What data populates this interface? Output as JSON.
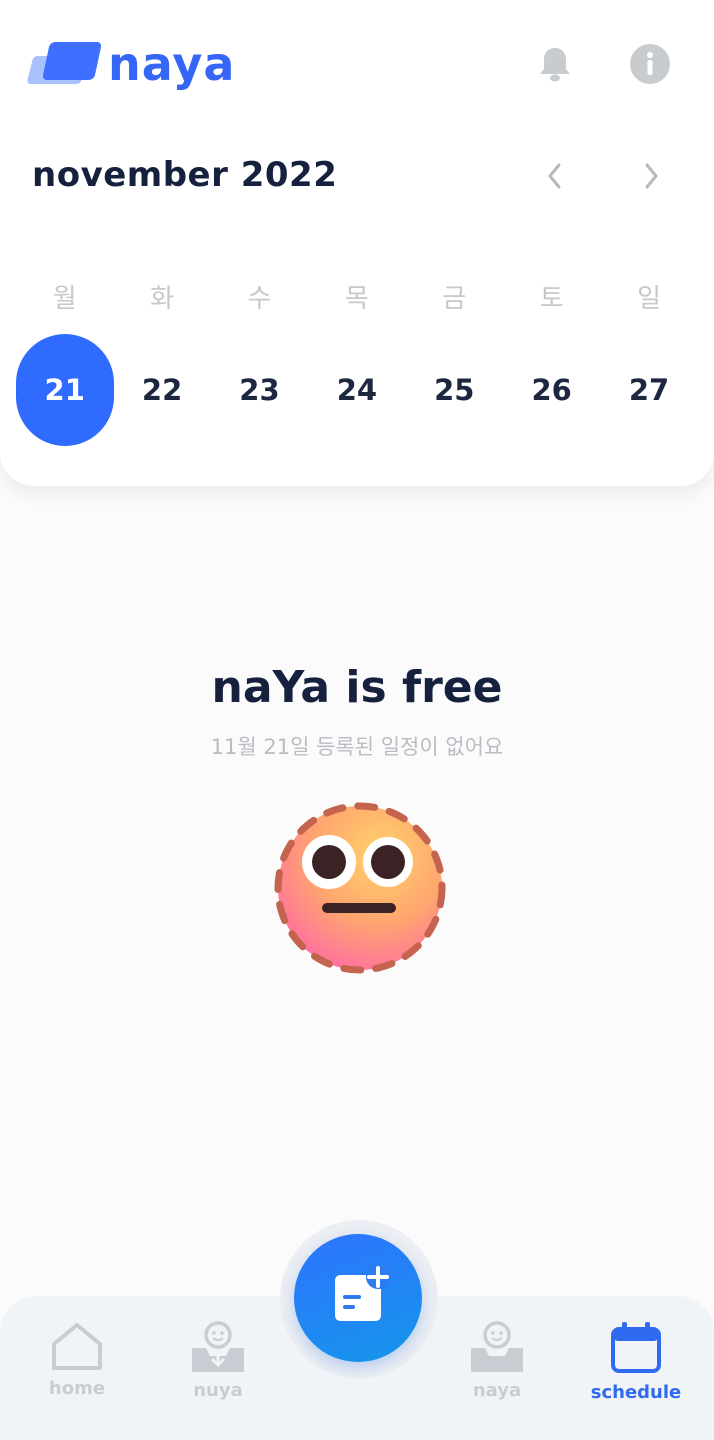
{
  "app": {
    "logo_text": "naya"
  },
  "header": {
    "month_title": "november 2022"
  },
  "week": [
    {
      "name": "월",
      "num": "21",
      "selected": true
    },
    {
      "name": "화",
      "num": "22",
      "selected": false
    },
    {
      "name": "수",
      "num": "23",
      "selected": false
    },
    {
      "name": "목",
      "num": "24",
      "selected": false
    },
    {
      "name": "금",
      "num": "25",
      "selected": false
    },
    {
      "name": "토",
      "num": "26",
      "selected": false
    },
    {
      "name": "일",
      "num": "27",
      "selected": false
    }
  ],
  "empty_state": {
    "title": "naYa is free",
    "subtitle": "11월 21일 등록된 일정이 없어요"
  },
  "bottom_nav": {
    "home": "home",
    "nuya": "nuya",
    "naya": "naya",
    "schedule": "schedule"
  },
  "colors": {
    "accent": "#2f6bff",
    "text_dark": "#16213e",
    "muted": "#c6c8cc"
  },
  "icons": [
    "bell-icon",
    "info-icon",
    "chevron-left-icon",
    "chevron-right-icon",
    "home-icon",
    "inbox-face-icon",
    "calendar-icon",
    "add-note-icon"
  ]
}
